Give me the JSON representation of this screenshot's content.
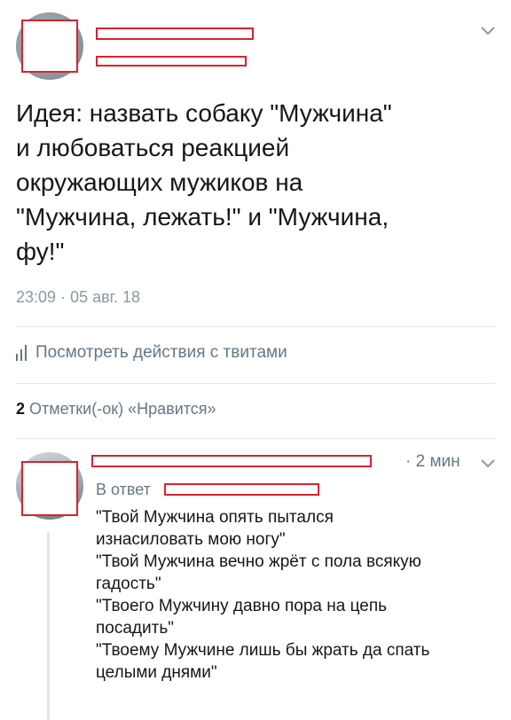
{
  "tweet": {
    "text_lines": [
      "Идея: назвать собаку \"Мужчина\"",
      "и любоваться реакцией",
      "окружающих мужиков на",
      "\"Мужчина, лежать!\" и \"Мужчина,",
      "фу!\""
    ],
    "time": "23:09",
    "separator": "·",
    "date": "05 авг. 18",
    "menu_icon": "chevron-down-icon"
  },
  "activity": {
    "icon": "bar-chart-icon",
    "label": "Посмотреть действия с твитами"
  },
  "likes": {
    "count": "2",
    "label": "Отметки(-ок) «Нравится»"
  },
  "reply": {
    "time": "· 2 мин",
    "reply_to_prefix": "В ответ",
    "menu_icon": "chevron-down-icon",
    "lines": [
      "\"Твой Мужчина опять пытался",
      "изнасиловать мою ногу\"",
      "\"Твой Мужчина вечно жрёт с пола всякую",
      "гадость\"",
      "\"Твоего Мужчину давно пора на цепь",
      "посадить\"",
      "\"Твоему Мужчине лишь бы жрать да спать",
      "целыми днями\""
    ]
  },
  "colors": {
    "redaction": "#d9232f",
    "secondary_text": "#657786",
    "divider": "#e1e8ed"
  }
}
